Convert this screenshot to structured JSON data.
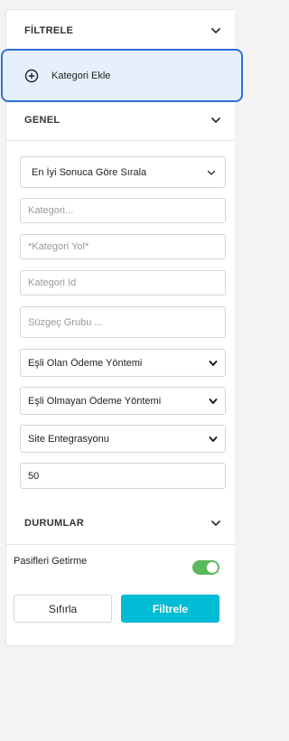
{
  "filters": {
    "title": "FİLTRELE",
    "icon": "chevron-down-icon"
  },
  "add_category": {
    "label": "Kategori Ekle",
    "icon": "plus-circle-icon"
  },
  "general": {
    "title": "GENEL",
    "sort_select": "En İyi Sonuca Göre Sırala",
    "category_placeholder": "Kategori...",
    "category_path_placeholder": "*Kategori Yol*",
    "category_id_placeholder": "Kategori Id",
    "filter_group_placeholder": "Süzgeç Grubu ...",
    "matching_payment_select": "Eşli Olan Ödeme Yöntemi",
    "non_matching_payment_select": "Eşli Olmayan Ödeme Yöntemi",
    "site_integration_select": "Site Entegrasyonu",
    "page_size_value": "50"
  },
  "statuses": {
    "title": "DURUMLAR",
    "exclude_passive_label": "Pasifleri Getirme",
    "exclude_passive_on": true
  },
  "actions": {
    "reset_label": "Sıfırla",
    "filter_label": "Filtrele"
  },
  "colors": {
    "accent": "#00bcd4",
    "focus_border": "#2f6fd6",
    "highlight_bg": "#e6f0fc",
    "toggle_on": "#5cb85c"
  }
}
